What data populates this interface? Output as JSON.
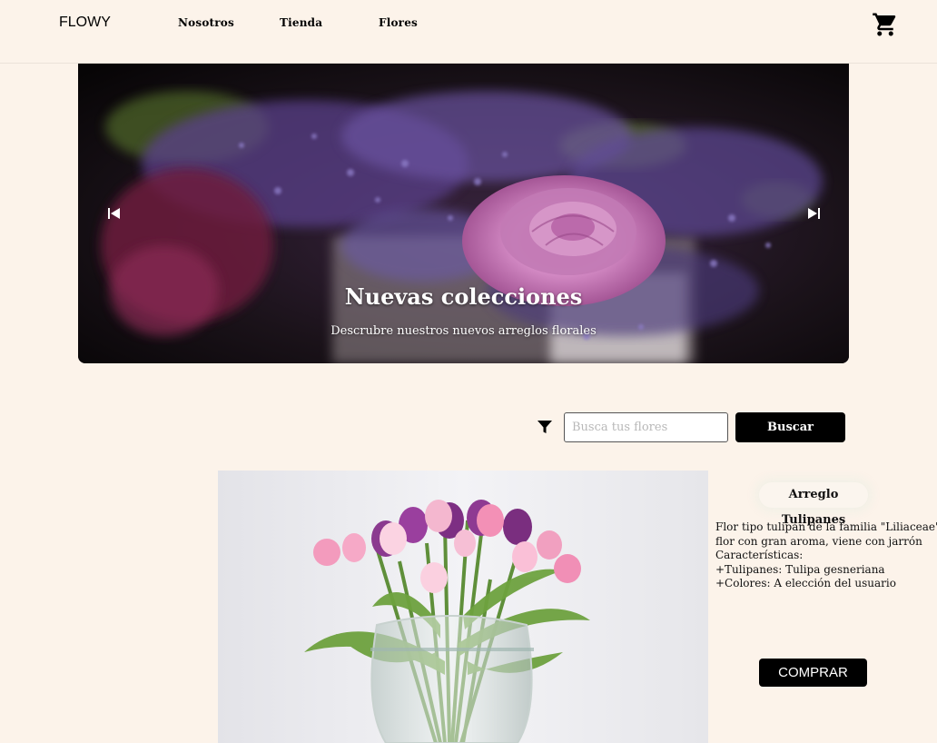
{
  "brand": "FLOWY",
  "nav": {
    "items": [
      {
        "label": "Nosotros"
      },
      {
        "label": "Tienda"
      },
      {
        "label": "Flores"
      }
    ]
  },
  "icons": {
    "cart": "shopping-cart-icon",
    "filter": "filter-icon",
    "prev": "skip-previous-icon",
    "next": "skip-next-icon"
  },
  "carousel": {
    "title": "Nuevas colecciones",
    "subtitle": "Descrubre nuestros nuevos arreglos florales"
  },
  "search": {
    "placeholder": "Busca tus flores",
    "value": "",
    "button_label": "Buscar"
  },
  "product": {
    "title": "Arreglo Tulipanes",
    "description": [
      "Flor tipo tulipán de la familia \"Liliaceae\"",
      "flor con gran aroma, viene con jarrón",
      "Características:",
      " +Tulipanes: Tulipa gesneriana",
      " +Colores: A elección del usuario"
    ],
    "buy_label": "COMPRAR"
  },
  "colors": {
    "background": "#fcf3ea",
    "button": "#000000",
    "button_text": "#ffffff"
  }
}
